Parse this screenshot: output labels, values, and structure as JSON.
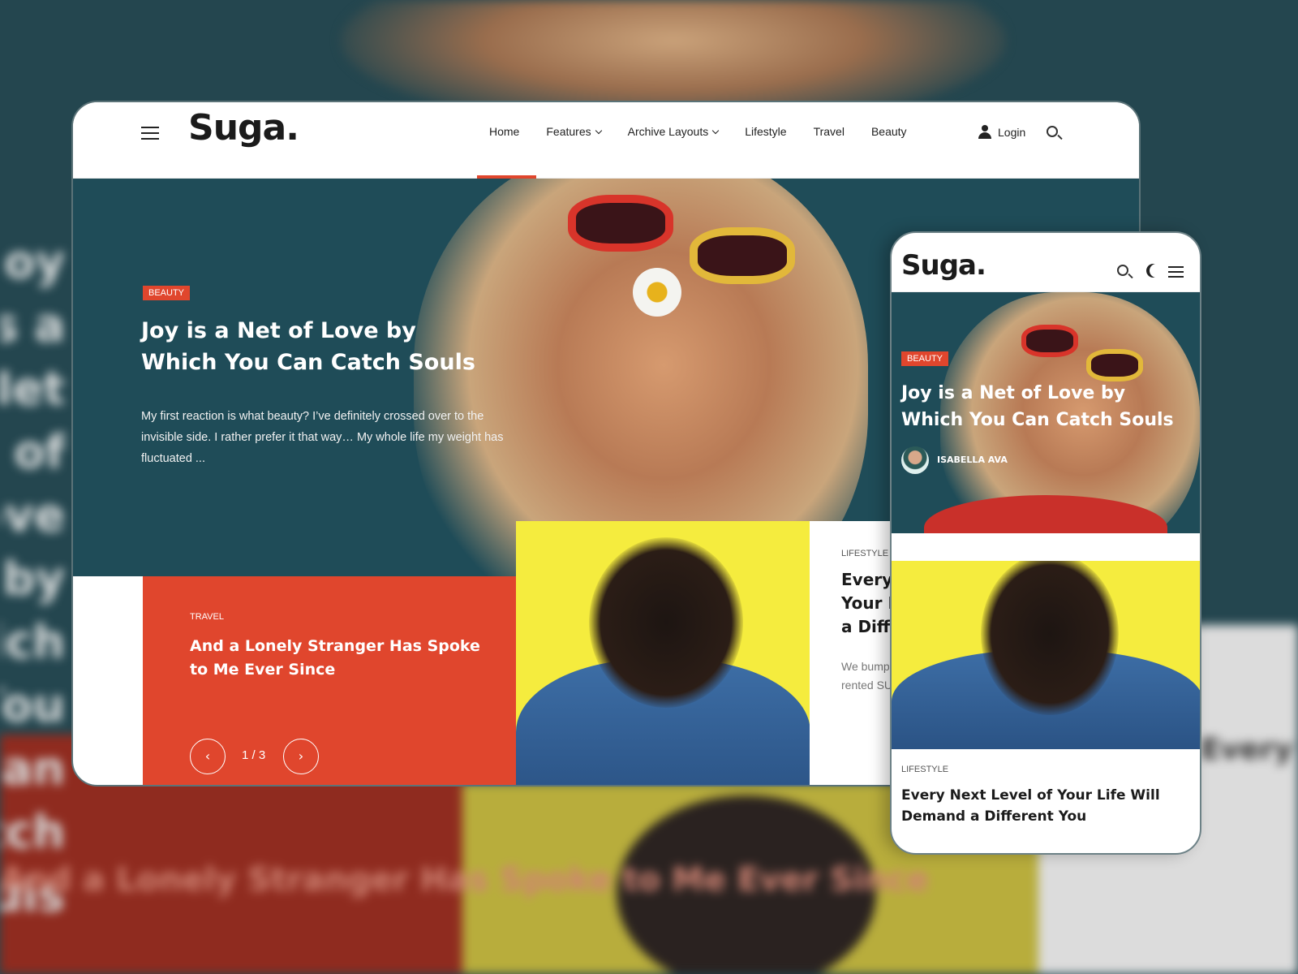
{
  "brand": {
    "logo": "Suga.",
    "accent_color": "#e0462d",
    "hero_bg_color": "#1f4c58",
    "yellow_color": "#f5ec3e"
  },
  "desktop": {
    "nav": {
      "items": [
        {
          "label": "Home",
          "active": true
        },
        {
          "label": "Features",
          "dropdown": true
        },
        {
          "label": "Archive Layouts",
          "dropdown": true
        },
        {
          "label": "Lifestyle"
        },
        {
          "label": "Travel"
        },
        {
          "label": "Beauty"
        }
      ],
      "login": "Login"
    },
    "hero": {
      "category": "BEAUTY",
      "title": "Joy is a Net of Love by Which You Can Catch Souls",
      "excerpt": "My first reaction is what beauty? I’ve definitely crossed over to the invisible side. I rather prefer it that way… My whole life my weight has fluctuated ..."
    },
    "slider": {
      "category": "TRAVEL",
      "title": "And a Lonely Stranger Has Spoke to Me Ever Since",
      "prev": "‹",
      "next": "›",
      "page": "1 / 3"
    },
    "lifestyle_card": {
      "category": "LIFESTYLE",
      "title": "Every Next Level of Your Life Will Demand a Different You",
      "excerpt": "We bumped along a dirt road in our rented SUV toward the trailhead"
    }
  },
  "mobile": {
    "hero": {
      "category": "BEAUTY",
      "title": "Joy is a Net of Love by Which You Can Catch Souls",
      "author": "ISABELLA AVA"
    },
    "card": {
      "category": "LIFESTYLE",
      "title": "Every Next Level of Your Life Will Demand a Different You"
    }
  }
}
